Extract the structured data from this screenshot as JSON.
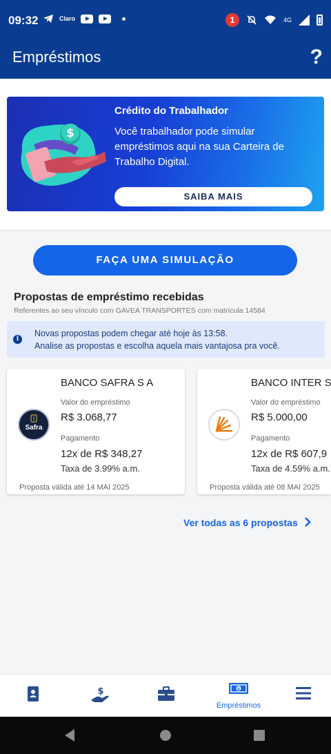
{
  "status_bar": {
    "time": "09:32",
    "carrier": "Claro",
    "notification_count": "1",
    "network": "4G"
  },
  "app_bar": {
    "title": "Empréstimos",
    "help_icon": "question-mark-icon"
  },
  "banner": {
    "title": "Crédito do Trabalhador",
    "text": "Você trabalhador pode simular empréstimos aqui na sua Carteira de Trabalho Digital.",
    "button_label": "SAIBA MAIS"
  },
  "simulate_button_label": "FAÇA UMA SIMULAÇÃO",
  "proposals": {
    "title": "Propostas de empréstimo recebidas",
    "subtitle": "Referentes ao seu vínculo com GAVEA TRANSPORTES com matrícula 14584",
    "info_line1": "Novas propostas podem chegar até hoje às 13:58.",
    "info_line2": "Analise as propostas e escolha aquela mais vantajosa pra você.",
    "cards": [
      {
        "bank": "BANCO SAFRA S A",
        "logo_text": "Safra",
        "amount_label": "Valor do empréstimo",
        "amount": "R$ 3.068,77",
        "payment_label": "Pagamento",
        "payment": "12x de R$ 348,27",
        "rate": "Taxa de 3.99% a.m.",
        "valid": "Proposta válida até 14 MAI 2025"
      },
      {
        "bank": "BANCO INTER S",
        "logo_text": "",
        "amount_label": "Valor do empréstimo",
        "amount": "R$ 5.000,00",
        "payment_label": "Pagamento",
        "payment": "12x de R$ 607,9",
        "rate": "Taxa de 4.59% a.m.",
        "valid": "Proposta válida até 08 MAI 2025"
      }
    ],
    "see_all": "Ver todas as 6 propostas"
  },
  "bottom_nav": {
    "items": [
      {
        "icon": "id-card-icon",
        "label": ""
      },
      {
        "icon": "money-hand-icon",
        "label": ""
      },
      {
        "icon": "briefcase-icon",
        "label": ""
      },
      {
        "icon": "banknote-icon",
        "label": "Empréstimos",
        "active": true
      },
      {
        "icon": "menu-icon",
        "label": ""
      }
    ]
  },
  "colors": {
    "primary": "#0a3d91",
    "accent": "#1565e8"
  }
}
